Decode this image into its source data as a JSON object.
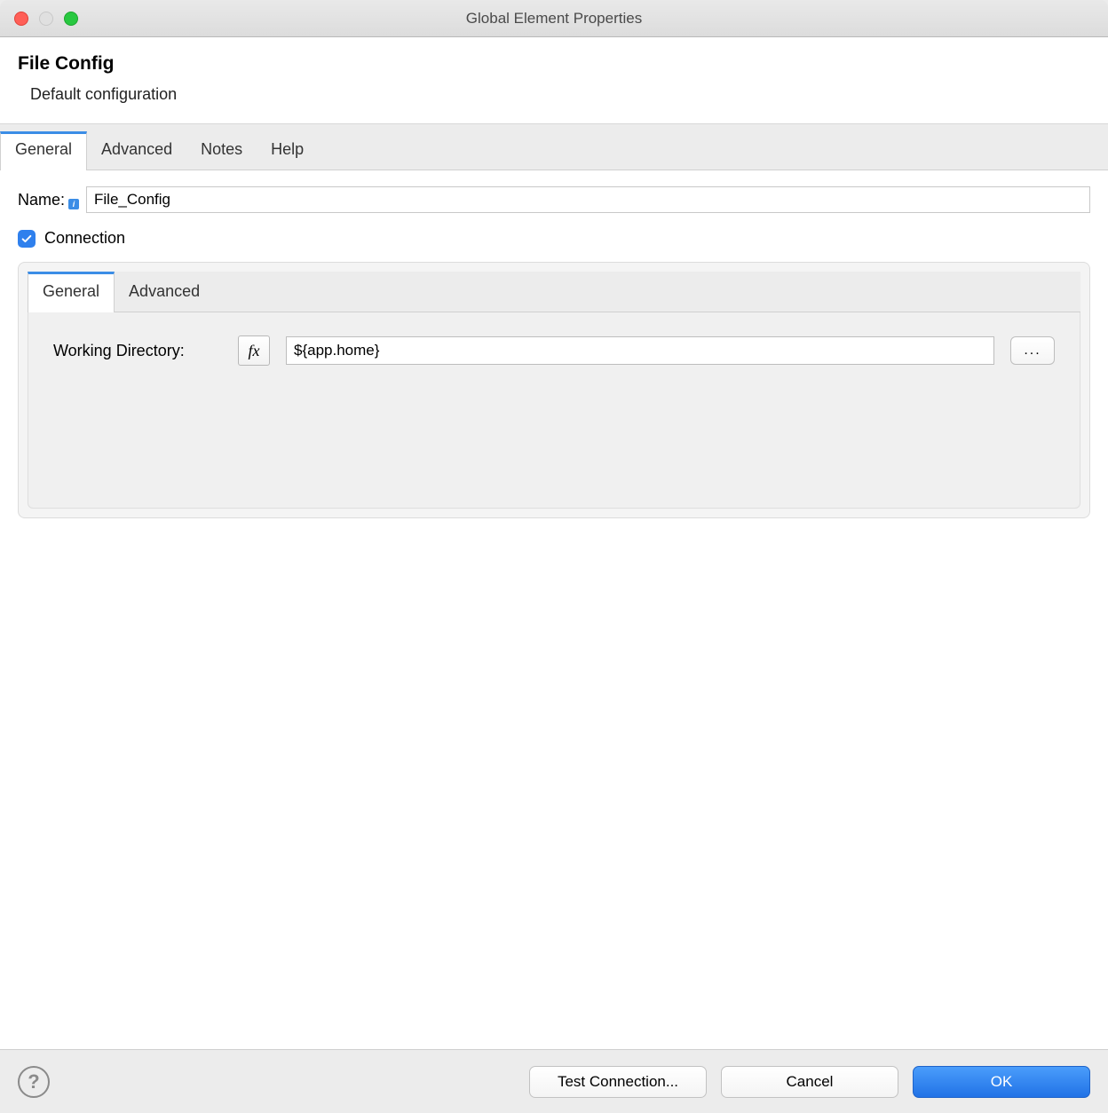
{
  "window": {
    "title": "Global Element Properties"
  },
  "header": {
    "title": "File Config",
    "subtitle": "Default configuration"
  },
  "tabs": {
    "general": "General",
    "advanced": "Advanced",
    "notes": "Notes",
    "help": "Help"
  },
  "form": {
    "name_label": "Name:",
    "name_value": "File_Config",
    "connection_label": "Connection"
  },
  "inner_tabs": {
    "general": "General",
    "advanced": "Advanced"
  },
  "connection": {
    "working_dir_label": "Working Directory:",
    "fx_label": "fx",
    "working_dir_value": "${app.home}",
    "browse_label": "..."
  },
  "footer": {
    "help": "?",
    "test": "Test Connection...",
    "cancel": "Cancel",
    "ok": "OK"
  }
}
